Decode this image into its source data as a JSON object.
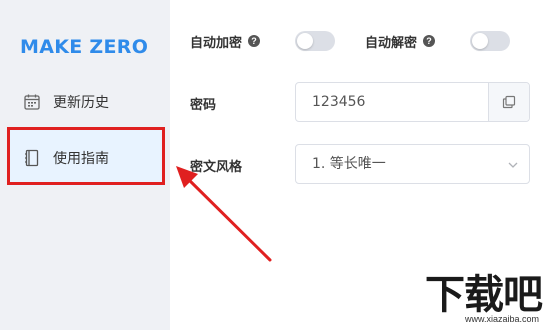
{
  "sidebar": {
    "brand": "MAKE ZERO",
    "items": [
      {
        "label": "更新历史",
        "icon": "calendar-icon"
      },
      {
        "label": "使用指南",
        "icon": "book-icon",
        "active": true
      }
    ]
  },
  "settings": {
    "auto_encrypt": {
      "label": "自动加密",
      "enabled": false
    },
    "auto_decrypt": {
      "label": "自动解密",
      "enabled": false
    },
    "password": {
      "label": "密码",
      "value": "123456"
    },
    "cipher_style": {
      "label": "密文风格",
      "selected": "1. 等长唯一"
    },
    "help_glyph": "?"
  },
  "annotation": {
    "color": "#e02020"
  },
  "watermark": {
    "title": "下载吧",
    "url": "www.xiazaiba.com"
  },
  "colors": {
    "brand": "#2f8bea",
    "sidebar_bg": "#eff1f5",
    "active_bg": "#e8f3ff"
  }
}
